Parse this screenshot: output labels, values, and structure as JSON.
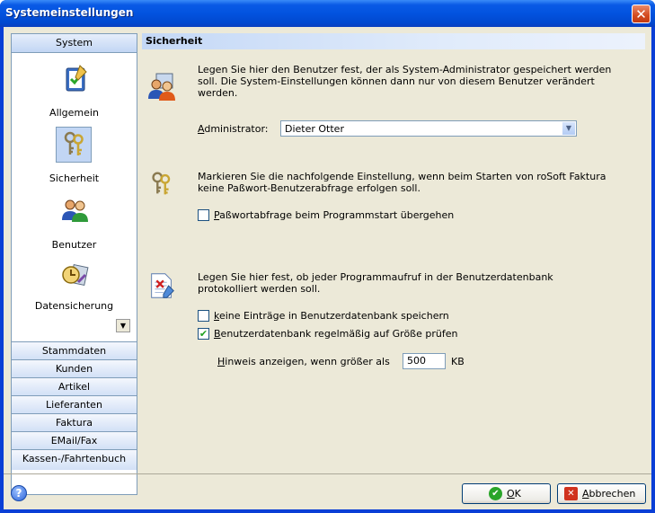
{
  "window": {
    "title": "Systemeinstellungen",
    "close_glyph": "✕"
  },
  "sidebar": {
    "header": "System",
    "items": [
      {
        "label": "Allgemein",
        "icon": "clipboard-check-icon"
      },
      {
        "label": "Sicherheit",
        "icon": "keys-icon",
        "selected": true
      },
      {
        "label": "Benutzer",
        "icon": "users-icon"
      },
      {
        "label": "Datensicherung",
        "icon": "backup-icon"
      }
    ],
    "scroll_glyph": "▼",
    "categories": [
      "Stammdaten",
      "Kunden",
      "Artikel",
      "Lieferanten",
      "Faktura",
      "EMail/Fax",
      "Kassen-/Fahrtenbuch"
    ]
  },
  "main": {
    "section_title": "Sicherheit",
    "admin": {
      "desc_line1": "Legen Sie hier den Benutzer fest, der als System-Administrator gespeichert werden",
      "desc_line2": "soll. Die System-Einstellungen können dann nur von diesem Benutzer verändert",
      "desc_line3": "werden.",
      "label_first": "A",
      "label_rest": "dministrator:",
      "value": "Dieter Otter"
    },
    "password": {
      "desc_line1": "Markieren Sie die nachfolgende Einstellung, wenn beim Starten von roSoft Faktura",
      "desc_line2": "keine Paßwort-Benutzerabfrage erfolgen soll.",
      "checkbox_first": "P",
      "checkbox_rest": "aßwortabfrage beim Programmstart übergehen",
      "checked": false
    },
    "logging": {
      "desc_line1": "Legen Sie hier fest, ob jeder Programmaufruf in der Benutzerdatenbank",
      "desc_line2": "protokolliert werden soll.",
      "opt1_first": "k",
      "opt1_rest": "eine Einträge in Benutzerdatenbank speichern",
      "opt1_checked": false,
      "opt2_first": "B",
      "opt2_rest": "enutzerdatenbank regelmäßig auf Größe prüfen",
      "opt2_checked": true,
      "check_glyph": "✔",
      "hint_first": "H",
      "hint_rest": "inweis anzeigen, wenn größer als",
      "size_value": "500",
      "size_unit": "KB"
    }
  },
  "footer": {
    "help_glyph": "?",
    "ok_first": "O",
    "ok_rest": "K",
    "ok_glyph": "✔",
    "cancel_first": "A",
    "cancel_rest": "bbrechen",
    "cancel_glyph": "✕"
  }
}
